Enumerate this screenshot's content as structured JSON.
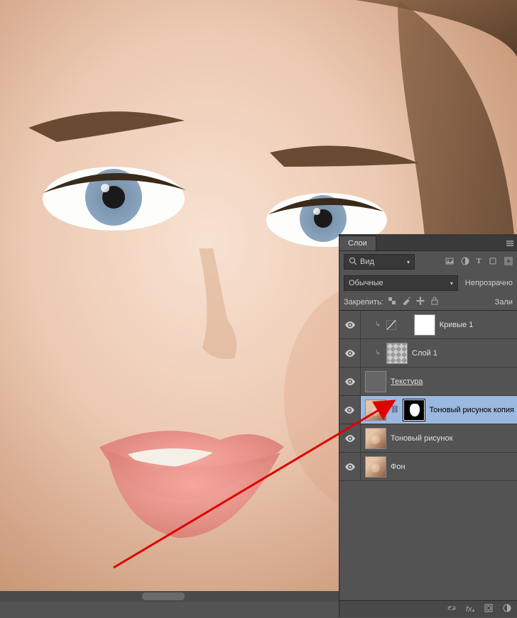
{
  "panel": {
    "tab_label": "Слои",
    "filter": {
      "type_label": "Вид",
      "icon_names": [
        "image-icon",
        "adjustment-icon",
        "type-icon",
        "shape-icon",
        "smartobject-icon"
      ]
    },
    "blend_mode": "Обычные",
    "opacity_label": "Непрозрачно",
    "lock_label": "Закрепить:",
    "fill_label": "Зали"
  },
  "layers": [
    {
      "name": "Кривые 1",
      "type": "adjustment",
      "selected": false,
      "clipped": true
    },
    {
      "name": "Слой 1",
      "type": "layer_checker",
      "selected": false,
      "clipped": true
    },
    {
      "name": "Текстура ",
      "type": "group",
      "selected": false,
      "underline": true
    },
    {
      "name": "Тоновый рисунок копия",
      "type": "layer_masked",
      "selected": true
    },
    {
      "name": "Тоновый рисунок",
      "type": "layer_face",
      "selected": false
    },
    {
      "name": "Фон",
      "type": "layer_face",
      "selected": false
    }
  ],
  "lock_icons": [
    "pixels-lock-icon",
    "brush-lock-icon",
    "move-icon",
    "lock-icon"
  ]
}
